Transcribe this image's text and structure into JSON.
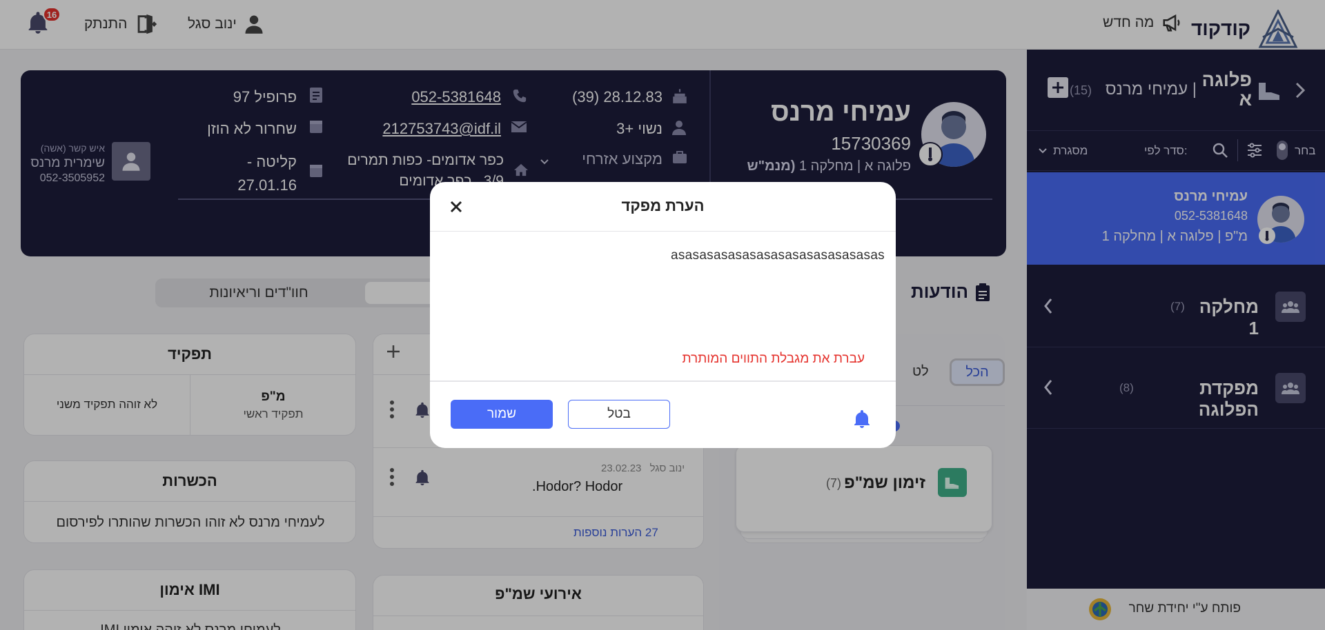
{
  "topbar": {
    "notifications_count": "16",
    "logout_label": "התנתק",
    "user_name": "ינוב סגל",
    "whats_new_label": "מה חדש",
    "app_name": "קודקוד"
  },
  "sidebar": {
    "header_unit": "פלוגה",
    "header_unit_line2": "א",
    "header_person": "| עמיחי מרנס",
    "header_count": "(15)",
    "select_label": "בחר",
    "sort_label": "סדר לפי:",
    "sort_value": "מסגרת",
    "selected": {
      "name": "עמיחי מרנס",
      "phone": "052-5381648",
      "meta": "מ\"פ | פלוגה א | מחלקה 1"
    },
    "groups": [
      {
        "label": "מחלקה 1",
        "count": "(7)"
      },
      {
        "label": "מפקדת הפלוגה",
        "count": "(8)"
      }
    ],
    "footer": "פותח ע\"י יחידת שחר"
  },
  "profile": {
    "name": "עמיחי מרנס",
    "id_number": "15730369",
    "unit_path": "פלוגה א | מחלקה 1",
    "role_short": "(מנמ\"ש",
    "birth": "28.12.83 (39)",
    "family": "נשוי +3",
    "profession": "מקצוע אזרחי",
    "phone": "052-5381648",
    "email": "212753743@idf.il",
    "address_line1": "כפר אדומים- כפות תמרים",
    "address_line2": "3/9 , כפר אדומים",
    "profile_grade": "פרופיל 97",
    "release": "שחרור לא הוזן",
    "intake_line1": "קליטה -",
    "intake_line2": "27.01.16",
    "contact_label": "איש קשר (אשה)",
    "contact_name": "שימרית מרנס",
    "contact_phone": "052-3505952"
  },
  "tabs": {
    "active": "",
    "other": "חוו\"דים וריאיונות"
  },
  "messages": {
    "title": "הודעות",
    "filter_all": "הכל",
    "filter_partial": "לט",
    "summons_label": "זימון שמ\"פ",
    "summons_count": "(7)"
  },
  "notes": {
    "note_author": "ינוב סגל",
    "note_date": "23.02.23",
    "note_text": "Hodor? Hodor.",
    "more_link": "27 הערות נוספות"
  },
  "events_card": {
    "title": "אירועי שמ\"פ"
  },
  "role_card": {
    "title": "תפקיד",
    "primary_value": "מ\"פ",
    "primary_label": "תפקיד ראשי",
    "secondary": "לא זוהה תפקיד משני"
  },
  "training_card": {
    "title": "הכשרות",
    "body": "לעמיחי מרנס לא זוהו הכשרות שהותרו לפירסום"
  },
  "imi_card": {
    "title": "אימון IMI",
    "body": "לעמיחי מרנס לא זוהה אימון IMI"
  },
  "modal": {
    "title": "הערת מפקד",
    "text": "asasasasasasasasasasasasasasas",
    "error": "עברת את מגבלת התווים המותרת",
    "cancel_label": "בטל",
    "save_label": "שמור"
  },
  "colors": {
    "accent": "#4a6cf7",
    "navy": "#1e1e3c",
    "error": "#e5322d",
    "badge": "#e5322d"
  }
}
